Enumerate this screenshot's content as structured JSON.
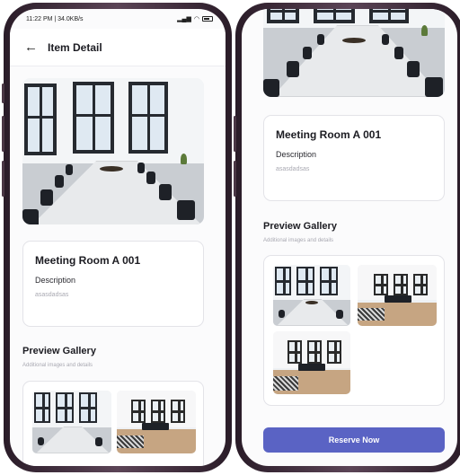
{
  "status_bar": {
    "time_text": "11:22 PM | 34.0KB/s",
    "icons": [
      "signal-icon",
      "wifi-icon",
      "battery-icon"
    ]
  },
  "app_bar": {
    "title": "Item Detail",
    "back_icon": "arrow-left-icon"
  },
  "item": {
    "name": "Meeting Room A 001",
    "description_label": "Description",
    "description_value": "asasdadsas"
  },
  "gallery": {
    "title": "Preview Gallery",
    "subtitle": "Additional images and details"
  },
  "actions": {
    "reserve_label": "Reserve Now"
  },
  "colors": {
    "accent": "#5a63c4",
    "frame": "#3b2a37",
    "text_primary": "#1c1c22",
    "text_muted": "#a9a9b2"
  }
}
